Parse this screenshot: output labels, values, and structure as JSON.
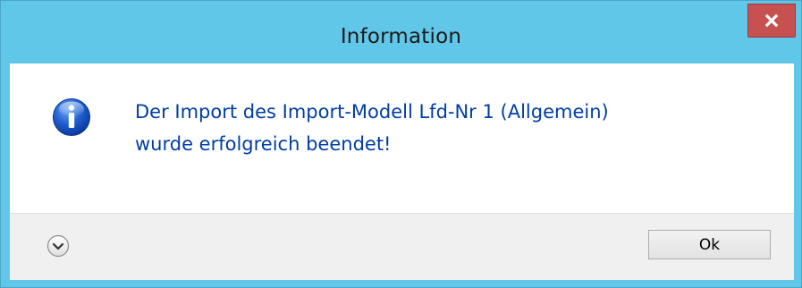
{
  "window": {
    "title": "Information"
  },
  "titlebar": {
    "close_icon": "close-icon",
    "close_color": "#c75050",
    "frame_color": "#61c7e9"
  },
  "message": {
    "icon": "info-icon",
    "line1": "Der Import des Import-Modell Lfd-Nr 1 (Allgemein)",
    "line2": "wurde erfolgreich beendet!",
    "text_color": "#003da5"
  },
  "footer": {
    "expand_icon": "chevron-down-circle-icon",
    "ok_label": "Ok"
  }
}
